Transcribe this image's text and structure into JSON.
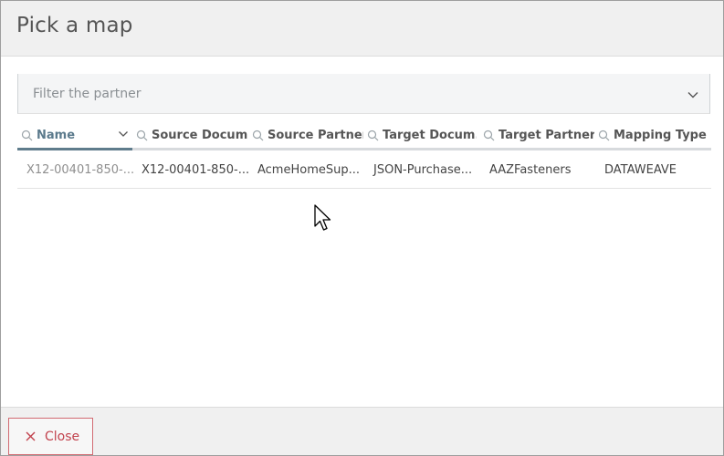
{
  "dialog": {
    "title": "Pick a map"
  },
  "filter": {
    "placeholder": "Filter the partner"
  },
  "table": {
    "columns": [
      {
        "label": "Name",
        "sorted": true
      },
      {
        "label": "Source Docum..."
      },
      {
        "label": "Source Partner"
      },
      {
        "label": "Target Docum..."
      },
      {
        "label": "Target Partner"
      },
      {
        "label": "Mapping Type"
      }
    ],
    "rows": [
      {
        "name": "X12-00401-850-...",
        "source_document": "X12-00401-850-...",
        "source_partner": "AcmeHomeSup...",
        "target_document": "JSON-Purchase...",
        "target_partner": "AAZFasteners",
        "mapping_type": "DATAWEAVE"
      }
    ]
  },
  "footer": {
    "close_label": "Close"
  },
  "colors": {
    "accent": "#5f7c8c",
    "danger": "#c2434e",
    "header_bg": "#f0f0f0"
  }
}
